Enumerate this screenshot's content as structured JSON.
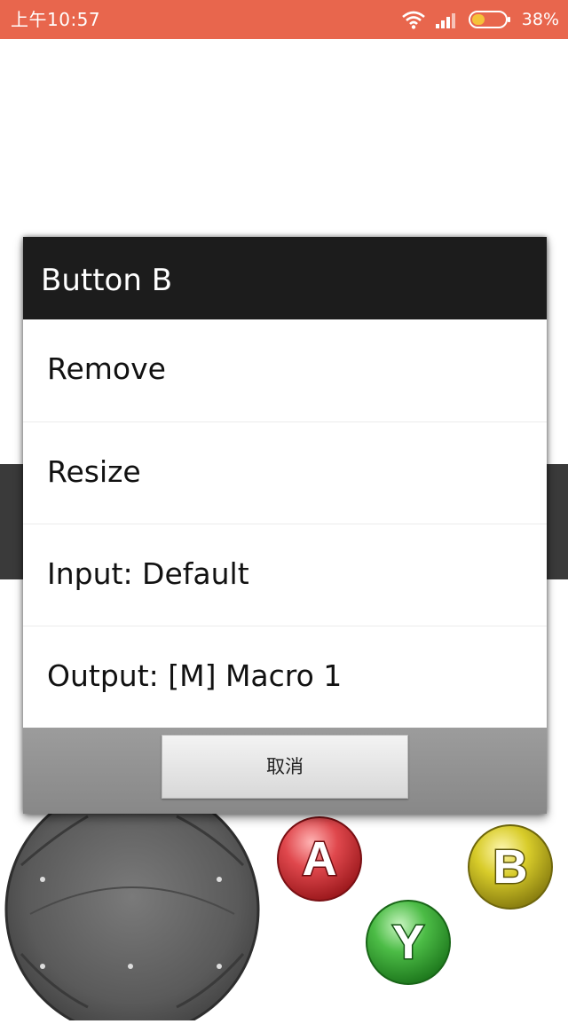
{
  "status_bar": {
    "time": "上午10:57",
    "battery_percent": "38%",
    "icons": [
      "wifi-icon",
      "signal-icon",
      "battery-icon"
    ],
    "battery_level": 0.38,
    "color": "#e8664d"
  },
  "dialog": {
    "title": "Button B",
    "items": [
      {
        "label": "Remove"
      },
      {
        "label": "Resize"
      },
      {
        "label": "Input: Default"
      },
      {
        "label": "Output: [M] Macro 1"
      }
    ],
    "cancel_label": "取消"
  },
  "game_buttons": {
    "a": {
      "label": "A",
      "color": "#d8282f"
    },
    "b": {
      "label": "B",
      "color": "#c9bd1f"
    },
    "y": {
      "label": "Y",
      "color": "#3eaa3a"
    }
  },
  "joystick": {
    "icon": "joystick-dpad-icon"
  }
}
